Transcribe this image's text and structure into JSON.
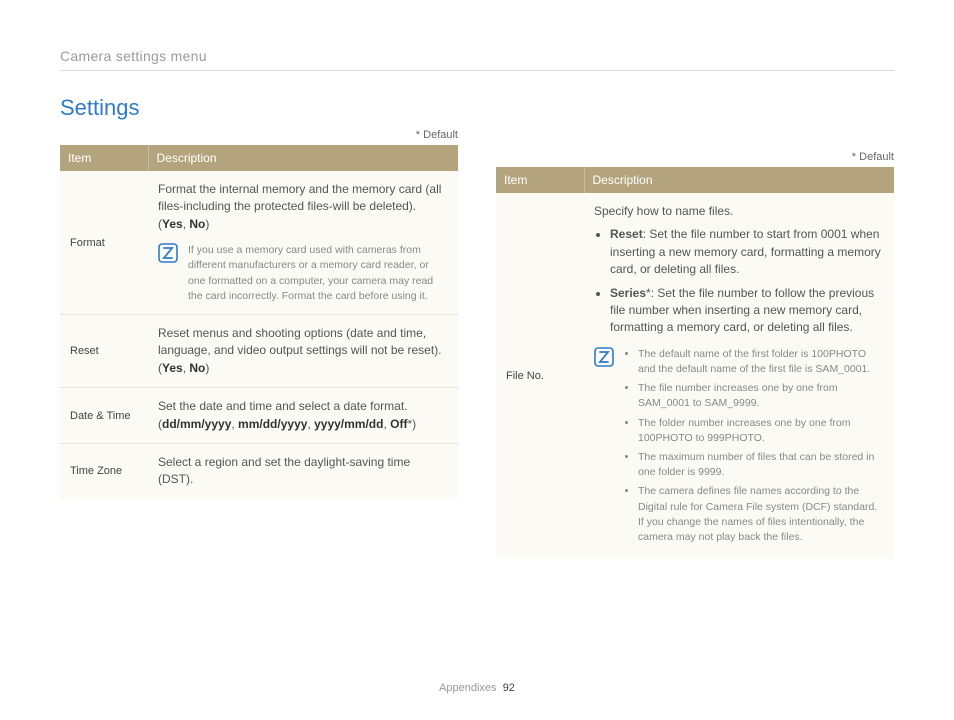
{
  "breadcrumb": "Camera settings menu",
  "section_title": "Settings",
  "default_label": "* Default",
  "table_headers": {
    "item": "Item",
    "description": "Description"
  },
  "left": {
    "format": {
      "item": "Format",
      "desc": "Format the internal memory and the memory card (all files-including the protected files-will be deleted).",
      "opts_open": "(",
      "yes": "Yes",
      "sep": ", ",
      "no": "No",
      "opts_close": ")",
      "note": "If you use a memory card used with cameras from different manufacturers or a memory card reader, or one formatted on a computer, your camera may read the card incorrectly. Format the card before using it."
    },
    "reset": {
      "item": "Reset",
      "desc": "Reset menus and shooting options (date and time, language, and video output settings will not be reset).",
      "opts_open": "(",
      "yes": "Yes",
      "sep": ", ",
      "no": "No",
      "opts_close": ")"
    },
    "datetime": {
      "item": "Date & Time",
      "desc": "Set the date and time and select a date format.",
      "opts_open": "(",
      "a": "dd/mm/yyyy",
      "b": "mm/dd/yyyy",
      "c": "yyyy/mm/dd",
      "d": "Off",
      "star": "*",
      "sep": ", ",
      "opts_close": ")"
    },
    "timezone": {
      "item": "Time Zone",
      "desc": "Select a region and set the daylight-saving time (DST)."
    }
  },
  "right": {
    "fileno": {
      "item": "File No.",
      "intro": "Specify how to name files.",
      "reset_label": "Reset",
      "reset_text": ": Set the file number to start from 0001 when inserting a new memory card, formatting a memory card, or deleting all files.",
      "series_label": "Series",
      "series_star": "*",
      "series_text": ": Set the file number to follow the previous file number when inserting a new memory card, formatting a memory card, or deleting all files.",
      "notes": {
        "n1": "The default name of the first folder is 100PHOTO and the default name of the first file is SAM_0001.",
        "n2": "The file number increases one by one from SAM_0001 to SAM_9999.",
        "n3": "The folder number increases one by one from 100PHOTO to 999PHOTO.",
        "n4": "The maximum number of files that can be stored in one folder is 9999.",
        "n5": "The camera defines file names according to the Digital rule for Camera File system (DCF) standard. If you change the names of files intentionally, the camera may not play back the files."
      }
    }
  },
  "footer": {
    "section": "Appendixes",
    "page": "92"
  }
}
